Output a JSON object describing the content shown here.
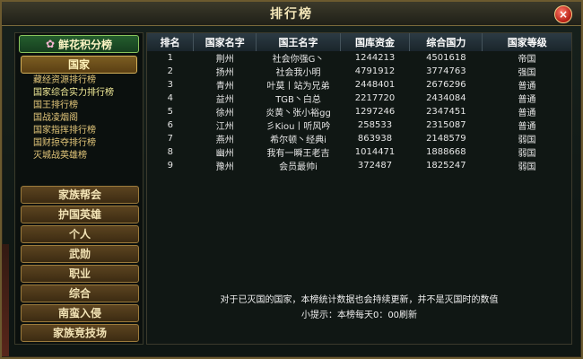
{
  "window": {
    "title": "排行榜",
    "close_label": "×"
  },
  "sidebar": {
    "flower_label": "鲜花积分榜",
    "nation_label": "国家",
    "subnav": [
      "藏经资源排行榜",
      "国家综合实力排行榜",
      "国王排行榜",
      "国战凌烟阁",
      "国家指挥排行榜",
      "国财掠夺排行榜",
      "灭城战英雄榜"
    ],
    "categories": [
      "家族帮会",
      "护国英雄",
      "个人",
      "武勋",
      "职业",
      "综合",
      "南蛮入侵",
      "家族竞技场"
    ]
  },
  "table": {
    "headers": [
      "排名",
      "国家名字",
      "国王名字",
      "国库资金",
      "综合国力",
      "国家等级"
    ],
    "rows": [
      [
        "1",
        "荆州",
        "社会你强G丶",
        "1244213",
        "4501618",
        "帝国"
      ],
      [
        "2",
        "扬州",
        "社会我小明",
        "4791912",
        "3774763",
        "强国"
      ],
      [
        "3",
        "青州",
        "叶莫丨站为兄弟",
        "2448401",
        "2676296",
        "普通"
      ],
      [
        "4",
        "益州",
        "TGB丶白总",
        "2217720",
        "2434084",
        "普通"
      ],
      [
        "5",
        "徐州",
        "炎黄丶张小裕gg",
        "1297246",
        "2347451",
        "普通"
      ],
      [
        "6",
        "江州",
        "彡Kiou丨听风吟",
        "258533",
        "2315087",
        "普通"
      ],
      [
        "7",
        "燕州",
        "希尔顿丶经典i",
        "863938",
        "2148579",
        "弱国"
      ],
      [
        "8",
        "幽州",
        "我有一瞬王老吉",
        "1014471",
        "1888668",
        "弱国"
      ],
      [
        "9",
        "豫州",
        "会员最帅i",
        "372487",
        "1825247",
        "弱国"
      ]
    ]
  },
  "footer": {
    "line1": "对于已灭国的国家，本榜统计数据也会持续更新，并不是灭国时的数值",
    "line2": "小提示：本榜每天0：00刷新"
  }
}
